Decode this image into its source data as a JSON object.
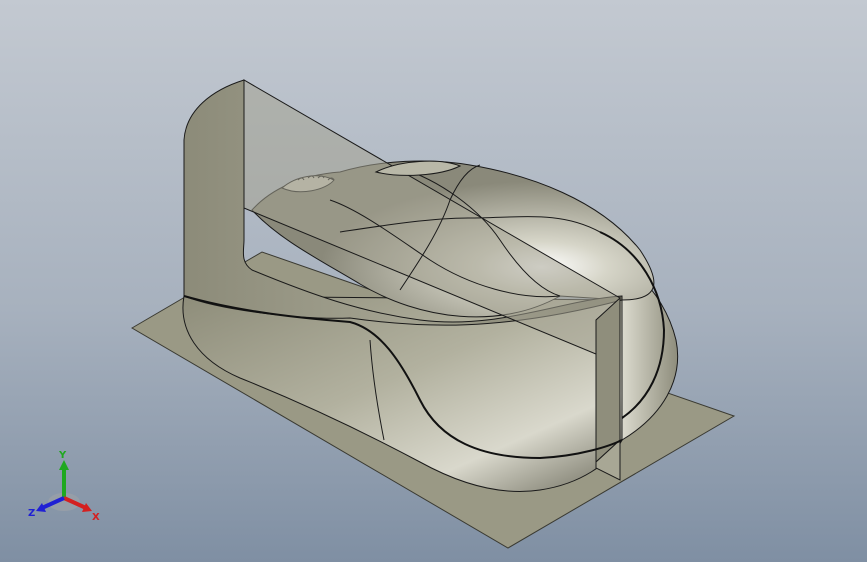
{
  "viewport": {
    "background_top": "#c3c9d1",
    "background_bottom": "#7f8fa3"
  },
  "model": {
    "surface_color": "#9b9a86",
    "highlight_color": "#f4f2ea",
    "edge_color": "#1a1a1a"
  },
  "triad": {
    "x_label": "X",
    "y_label": "Y",
    "z_label": "Z",
    "x_color": "#d42020",
    "y_color": "#1fa81f",
    "z_color": "#2020d4"
  }
}
